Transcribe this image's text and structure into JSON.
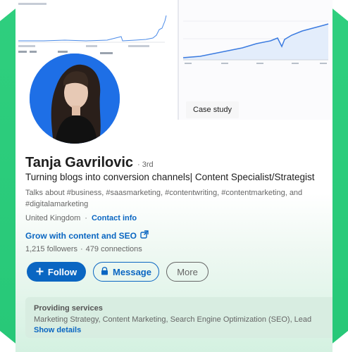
{
  "profile": {
    "name": "Tanja Gavrilovic",
    "degree": "· 3rd",
    "headline": "Turning blogs into conversion channels| Content Specialist/Strategist",
    "talks_about": "Talks about #business, #saasmarketing, #contentwriting, #contentmarketing, and #digitalamarketing",
    "location": "United Kingdom",
    "contact_info": "Contact info",
    "website_link": "Grow with content and SEO",
    "followers": "1,215 followers",
    "separator": "·",
    "connections": "479 connections"
  },
  "featured": {
    "case_study_label": "Case study"
  },
  "actions": {
    "follow": "Follow",
    "message": "Message",
    "more": "More"
  },
  "services": {
    "title": "Providing services",
    "list": "Marketing Strategy, Content Marketing, Search Engine Optimization (SEO), Lead",
    "details": "Show details"
  },
  "colors": {
    "brand_blue": "#0a66c2",
    "accent_green": "#2fcf7e",
    "avatar_bg": "#1e6fe6"
  },
  "icons": {
    "follow": "plus-icon",
    "message": "lock-icon",
    "link": "external-link-icon"
  }
}
